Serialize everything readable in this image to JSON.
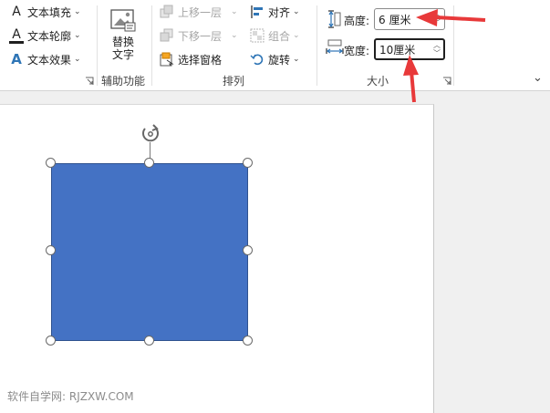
{
  "ribbon": {
    "style_group": {
      "text_fill": "文本填充",
      "text_outline": "文本轮廓",
      "text_effects": "文本效果",
      "text_fill_icon": "A",
      "text_outline_icon": "A",
      "text_effects_icon": "A"
    },
    "accessibility": {
      "alt_text_line1": "替换",
      "alt_text_line2": "文字",
      "group_label": "辅助功能"
    },
    "arrange": {
      "bring_forward": "上移一层",
      "send_backward": "下移一层",
      "selection_pane": "选择窗格",
      "align": "对齐",
      "group": "组合",
      "rotate": "旋转",
      "group_label": "排列"
    },
    "size": {
      "height_label": "高度:",
      "height_value": "6 厘米",
      "width_label": "宽度:",
      "width_value": "10厘米",
      "group_label": "大小"
    }
  },
  "colors": {
    "shape_fill": "#4472c4",
    "annotation_arrow": "#e8393a"
  },
  "watermark": "软件自学网: RJZXW.COM"
}
